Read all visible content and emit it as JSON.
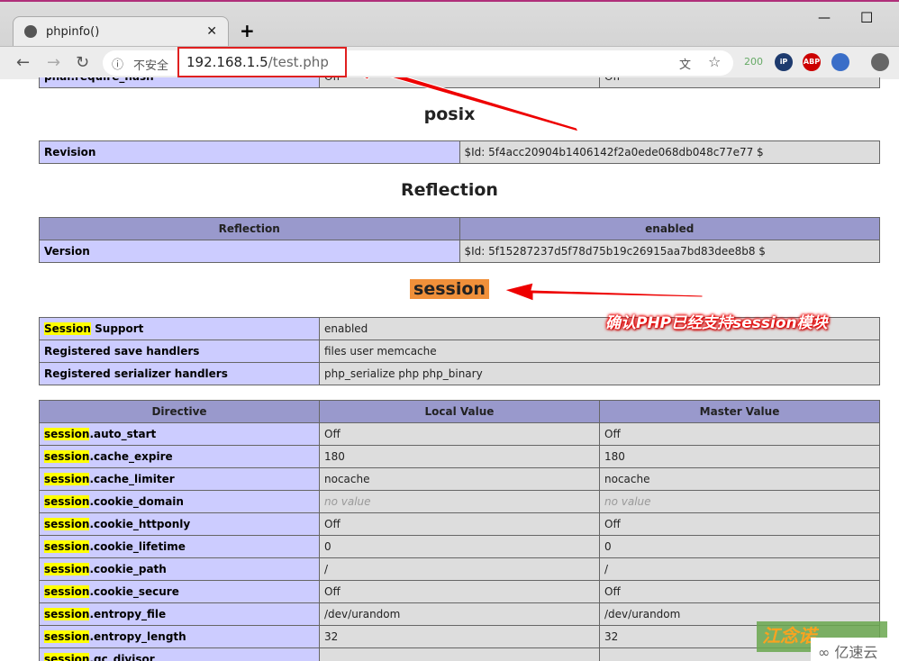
{
  "browser": {
    "tab_title": "phpinfo()",
    "insecure_label": "不安全",
    "url_host": "192.168.1.5",
    "url_path": "/test.php",
    "ext_count": "200",
    "ext_ip": "iP",
    "ext_abp": "ABP"
  },
  "partial_row": {
    "name": "phar.require_hash",
    "local": "Off",
    "master": "Off"
  },
  "posix": {
    "title": "posix",
    "rows": [
      {
        "name": "Revision",
        "value": "$Id: 5f4acc20904b1406142f2a0ede068db048c77e77 $"
      }
    ]
  },
  "reflection": {
    "title": "Reflection",
    "header": [
      "Reflection",
      "enabled"
    ],
    "rows": [
      {
        "name": "Version",
        "value": "$Id: 5f15287237d5f78d75b19c26915aa7bd83dee8b8 $"
      }
    ]
  },
  "session": {
    "title": "session",
    "annotation": "确认PHP已经支持session模块",
    "info_rows": [
      {
        "hl": "Session",
        "name": " Support",
        "value": "enabled"
      },
      {
        "hl": "",
        "name": "Registered save handlers",
        "value": "files user memcache"
      },
      {
        "hl": "",
        "name": "Registered serializer handlers",
        "value": "php_serialize php php_binary"
      }
    ],
    "directive_headers": [
      "Directive",
      "Local Value",
      "Master Value"
    ],
    "directives": [
      {
        "hl": "session",
        "name": ".auto_start",
        "local": "Off",
        "master": "Off"
      },
      {
        "hl": "session",
        "name": ".cache_expire",
        "local": "180",
        "master": "180"
      },
      {
        "hl": "session",
        "name": ".cache_limiter",
        "local": "nocache",
        "master": "nocache"
      },
      {
        "hl": "session",
        "name": ".cookie_domain",
        "local": "no value",
        "master": "no value"
      },
      {
        "hl": "session",
        "name": ".cookie_httponly",
        "local": "Off",
        "master": "Off"
      },
      {
        "hl": "session",
        "name": ".cookie_lifetime",
        "local": "0",
        "master": "0"
      },
      {
        "hl": "session",
        "name": ".cookie_path",
        "local": "/",
        "master": "/"
      },
      {
        "hl": "session",
        "name": ".cookie_secure",
        "local": "Off",
        "master": "Off"
      },
      {
        "hl": "session",
        "name": ".entropy_file",
        "local": "/dev/urandom",
        "master": "/dev/urandom"
      },
      {
        "hl": "session",
        "name": ".entropy_length",
        "local": "32",
        "master": "32"
      },
      {
        "hl": "session",
        "name": ".gc_divisor",
        "local": "",
        "master": ""
      }
    ]
  },
  "watermark": {
    "text1": "江念诺",
    "text2": "亿速云"
  }
}
